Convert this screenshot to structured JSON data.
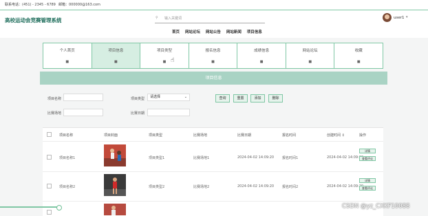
{
  "topbar": {
    "phone": "联系电话：(451) - 2345 - 6789",
    "email": "邮箱：000000@163.com"
  },
  "header": {
    "title": "高校运动会竞赛管理系统",
    "search_placeholder": "输入关键词",
    "nav": [
      "首页",
      "网站论坛",
      "网站公告",
      "网站新闻",
      "项目信息"
    ],
    "user": "user1"
  },
  "tabs": [
    {
      "label": "个人首页"
    },
    {
      "label": "项目信息"
    },
    {
      "label": "项目类型"
    },
    {
      "label": "报名信息"
    },
    {
      "label": "成绩信息"
    },
    {
      "label": "网站论坛"
    },
    {
      "label": "收藏"
    }
  ],
  "banner": "项目信息",
  "filters": {
    "name_label": "项目名称",
    "type_label": "项目类型",
    "type_value": "请选择",
    "venue_label": "比赛场地",
    "date_label": "比赛日期"
  },
  "buttons": {
    "query": "查询",
    "reset": "重置",
    "add": "添加",
    "delete": "删除"
  },
  "table": {
    "headers": [
      "项目名称",
      "项目封面",
      "项目类型",
      "比赛场地",
      "比赛日期",
      "报名时间",
      "创建时间 ↕",
      "操作"
    ],
    "rows": [
      {
        "name": "项目名称1",
        "type": "项目类型1",
        "venue": "比赛场地1",
        "date": "2024-04-02 14:09:20",
        "signup": "报名时间1",
        "created": "2024-04-02 14:09:20"
      },
      {
        "name": "项目名称2",
        "type": "项目类型2",
        "venue": "比赛场地2",
        "date": "2024-04-02 14:09:20",
        "signup": "报名时间2",
        "created": "2024-04-02 14:09:20"
      }
    ],
    "action_detail": "详情",
    "action_review": "查看评论"
  },
  "watermark": "CSDN @yz_CXKF10088",
  "colors": {
    "accent": "#7fc7a4",
    "banner": "#a9d3c4",
    "active_tab": "#d6eee2",
    "title": "#1f6e5c"
  }
}
